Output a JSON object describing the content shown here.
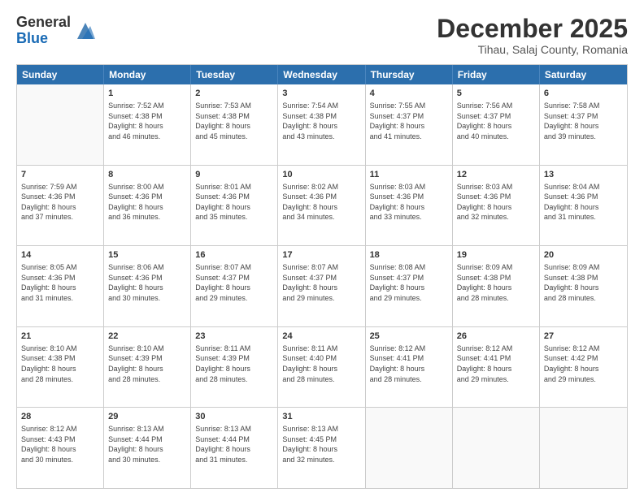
{
  "header": {
    "logo_general": "General",
    "logo_blue": "Blue",
    "month_year": "December 2025",
    "location": "Tihau, Salaj County, Romania"
  },
  "calendar": {
    "days_of_week": [
      "Sunday",
      "Monday",
      "Tuesday",
      "Wednesday",
      "Thursday",
      "Friday",
      "Saturday"
    ],
    "rows": [
      [
        {
          "day": "",
          "empty": true,
          "lines": []
        },
        {
          "day": "1",
          "empty": false,
          "lines": [
            "Sunrise: 7:52 AM",
            "Sunset: 4:38 PM",
            "Daylight: 8 hours",
            "and 46 minutes."
          ]
        },
        {
          "day": "2",
          "empty": false,
          "lines": [
            "Sunrise: 7:53 AM",
            "Sunset: 4:38 PM",
            "Daylight: 8 hours",
            "and 45 minutes."
          ]
        },
        {
          "day": "3",
          "empty": false,
          "lines": [
            "Sunrise: 7:54 AM",
            "Sunset: 4:38 PM",
            "Daylight: 8 hours",
            "and 43 minutes."
          ]
        },
        {
          "day": "4",
          "empty": false,
          "lines": [
            "Sunrise: 7:55 AM",
            "Sunset: 4:37 PM",
            "Daylight: 8 hours",
            "and 41 minutes."
          ]
        },
        {
          "day": "5",
          "empty": false,
          "lines": [
            "Sunrise: 7:56 AM",
            "Sunset: 4:37 PM",
            "Daylight: 8 hours",
            "and 40 minutes."
          ]
        },
        {
          "day": "6",
          "empty": false,
          "lines": [
            "Sunrise: 7:58 AM",
            "Sunset: 4:37 PM",
            "Daylight: 8 hours",
            "and 39 minutes."
          ]
        }
      ],
      [
        {
          "day": "7",
          "empty": false,
          "lines": [
            "Sunrise: 7:59 AM",
            "Sunset: 4:36 PM",
            "Daylight: 8 hours",
            "and 37 minutes."
          ]
        },
        {
          "day": "8",
          "empty": false,
          "lines": [
            "Sunrise: 8:00 AM",
            "Sunset: 4:36 PM",
            "Daylight: 8 hours",
            "and 36 minutes."
          ]
        },
        {
          "day": "9",
          "empty": false,
          "lines": [
            "Sunrise: 8:01 AM",
            "Sunset: 4:36 PM",
            "Daylight: 8 hours",
            "and 35 minutes."
          ]
        },
        {
          "day": "10",
          "empty": false,
          "lines": [
            "Sunrise: 8:02 AM",
            "Sunset: 4:36 PM",
            "Daylight: 8 hours",
            "and 34 minutes."
          ]
        },
        {
          "day": "11",
          "empty": false,
          "lines": [
            "Sunrise: 8:03 AM",
            "Sunset: 4:36 PM",
            "Daylight: 8 hours",
            "and 33 minutes."
          ]
        },
        {
          "day": "12",
          "empty": false,
          "lines": [
            "Sunrise: 8:03 AM",
            "Sunset: 4:36 PM",
            "Daylight: 8 hours",
            "and 32 minutes."
          ]
        },
        {
          "day": "13",
          "empty": false,
          "lines": [
            "Sunrise: 8:04 AM",
            "Sunset: 4:36 PM",
            "Daylight: 8 hours",
            "and 31 minutes."
          ]
        }
      ],
      [
        {
          "day": "14",
          "empty": false,
          "lines": [
            "Sunrise: 8:05 AM",
            "Sunset: 4:36 PM",
            "Daylight: 8 hours",
            "and 31 minutes."
          ]
        },
        {
          "day": "15",
          "empty": false,
          "lines": [
            "Sunrise: 8:06 AM",
            "Sunset: 4:36 PM",
            "Daylight: 8 hours",
            "and 30 minutes."
          ]
        },
        {
          "day": "16",
          "empty": false,
          "lines": [
            "Sunrise: 8:07 AM",
            "Sunset: 4:37 PM",
            "Daylight: 8 hours",
            "and 29 minutes."
          ]
        },
        {
          "day": "17",
          "empty": false,
          "lines": [
            "Sunrise: 8:07 AM",
            "Sunset: 4:37 PM",
            "Daylight: 8 hours",
            "and 29 minutes."
          ]
        },
        {
          "day": "18",
          "empty": false,
          "lines": [
            "Sunrise: 8:08 AM",
            "Sunset: 4:37 PM",
            "Daylight: 8 hours",
            "and 29 minutes."
          ]
        },
        {
          "day": "19",
          "empty": false,
          "lines": [
            "Sunrise: 8:09 AM",
            "Sunset: 4:38 PM",
            "Daylight: 8 hours",
            "and 28 minutes."
          ]
        },
        {
          "day": "20",
          "empty": false,
          "lines": [
            "Sunrise: 8:09 AM",
            "Sunset: 4:38 PM",
            "Daylight: 8 hours",
            "and 28 minutes."
          ]
        }
      ],
      [
        {
          "day": "21",
          "empty": false,
          "lines": [
            "Sunrise: 8:10 AM",
            "Sunset: 4:38 PM",
            "Daylight: 8 hours",
            "and 28 minutes."
          ]
        },
        {
          "day": "22",
          "empty": false,
          "lines": [
            "Sunrise: 8:10 AM",
            "Sunset: 4:39 PM",
            "Daylight: 8 hours",
            "and 28 minutes."
          ]
        },
        {
          "day": "23",
          "empty": false,
          "lines": [
            "Sunrise: 8:11 AM",
            "Sunset: 4:39 PM",
            "Daylight: 8 hours",
            "and 28 minutes."
          ]
        },
        {
          "day": "24",
          "empty": false,
          "lines": [
            "Sunrise: 8:11 AM",
            "Sunset: 4:40 PM",
            "Daylight: 8 hours",
            "and 28 minutes."
          ]
        },
        {
          "day": "25",
          "empty": false,
          "lines": [
            "Sunrise: 8:12 AM",
            "Sunset: 4:41 PM",
            "Daylight: 8 hours",
            "and 28 minutes."
          ]
        },
        {
          "day": "26",
          "empty": false,
          "lines": [
            "Sunrise: 8:12 AM",
            "Sunset: 4:41 PM",
            "Daylight: 8 hours",
            "and 29 minutes."
          ]
        },
        {
          "day": "27",
          "empty": false,
          "lines": [
            "Sunrise: 8:12 AM",
            "Sunset: 4:42 PM",
            "Daylight: 8 hours",
            "and 29 minutes."
          ]
        }
      ],
      [
        {
          "day": "28",
          "empty": false,
          "lines": [
            "Sunrise: 8:12 AM",
            "Sunset: 4:43 PM",
            "Daylight: 8 hours",
            "and 30 minutes."
          ]
        },
        {
          "day": "29",
          "empty": false,
          "lines": [
            "Sunrise: 8:13 AM",
            "Sunset: 4:44 PM",
            "Daylight: 8 hours",
            "and 30 minutes."
          ]
        },
        {
          "day": "30",
          "empty": false,
          "lines": [
            "Sunrise: 8:13 AM",
            "Sunset: 4:44 PM",
            "Daylight: 8 hours",
            "and 31 minutes."
          ]
        },
        {
          "day": "31",
          "empty": false,
          "lines": [
            "Sunrise: 8:13 AM",
            "Sunset: 4:45 PM",
            "Daylight: 8 hours",
            "and 32 minutes."
          ]
        },
        {
          "day": "",
          "empty": true,
          "lines": []
        },
        {
          "day": "",
          "empty": true,
          "lines": []
        },
        {
          "day": "",
          "empty": true,
          "lines": []
        }
      ]
    ]
  }
}
